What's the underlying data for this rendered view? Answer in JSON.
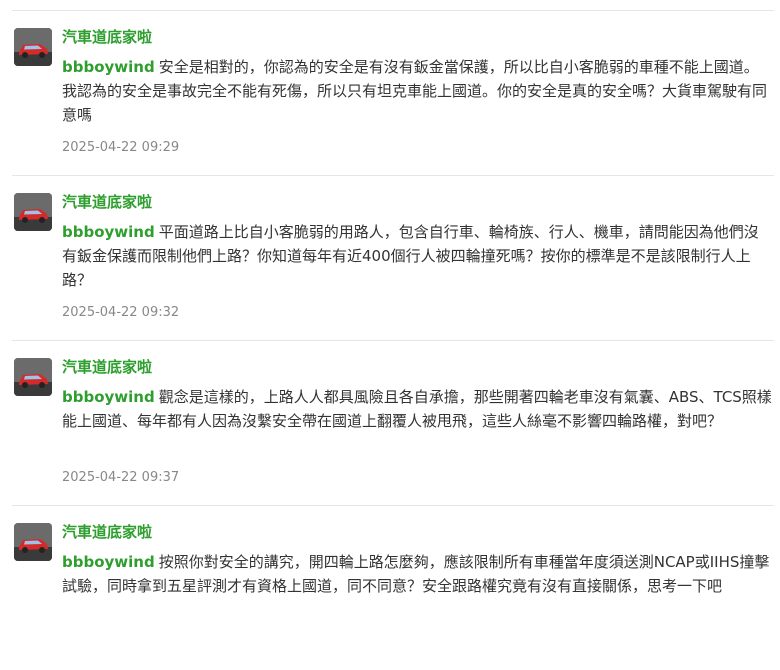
{
  "comments": [
    {
      "author": "汽車道底家啦",
      "mention": "bbboywind",
      "text": "安全是相對的，你認為的安全是有沒有鈑金當保護，所以比自小客脆弱的車種不能上國道。我認為的安全是事故完全不能有死傷，所以只有坦克車能上國道。你的安全是真的安全嗎？大貨車駕駛有同意嗎",
      "time": "2025-04-22 09:29"
    },
    {
      "author": "汽車道底家啦",
      "mention": "bbboywind",
      "text": "平面道路上比自小客脆弱的用路人，包含自行車、輪椅族、行人、機車，請問能因為他們沒有鈑金保護而限制他們上路？你知道每年有近400個行人被四輪撞死嗎？按你的標準是不是該限制行人上路？",
      "time": "2025-04-22 09:32"
    },
    {
      "author": "汽車道底家啦",
      "mention": "bbboywind",
      "text": "觀念是這樣的，上路人人都具風險且各自承擔，那些開著四輪老車沒有氣囊、ABS、TCS照樣能上國道、每年都有人因為沒繫安全帶在國道上翻覆人被甩飛，這些人絲毫不影響四輪路權，對吧？",
      "time": "2025-04-22 09:37"
    },
    {
      "author": "汽車道底家啦",
      "mention": "bbboywind",
      "text": "按照你對安全的講究，開四輪上路怎麼夠，應該限制所有車種當年度須送測NCAP或IIHS撞擊試驗，同時拿到五星評測才有資格上國道，同不同意？安全跟路權究竟有沒有直接關係，思考一下吧",
      "time": ""
    }
  ],
  "icons": {
    "avatar": "red-car-avatar-icon"
  },
  "colors": {
    "author": "#2e9e2e",
    "timestamp": "#888888",
    "divider": "#e6e6e6"
  }
}
